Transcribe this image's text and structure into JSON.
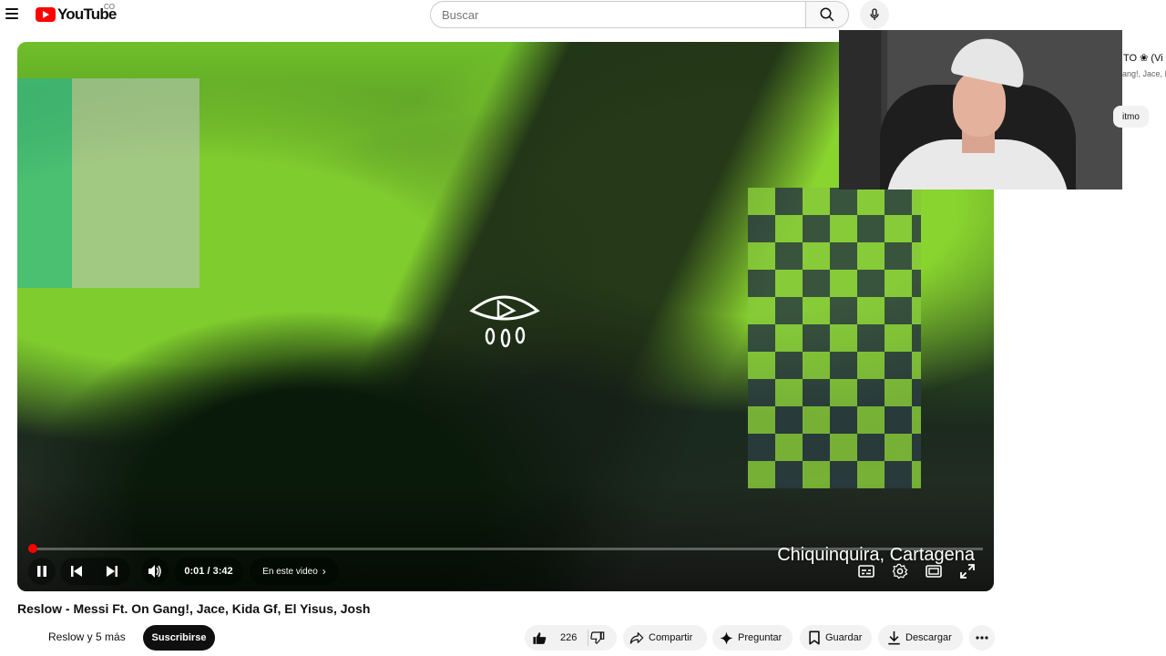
{
  "header": {
    "logo_text": "YouTube",
    "country_code": "CO",
    "search_placeholder": "Buscar"
  },
  "player": {
    "caption": "Chiquinquira, Cartagena",
    "time_display": "0:01 / 3:42",
    "chapter_label": "En este video",
    "progress_fraction": 0.005,
    "accent_color": "#ff0000"
  },
  "sidebar_partial": {
    "line1": "TO ❀ (Vi",
    "line2": "ang!, Jace, I",
    "chip": "itmo"
  },
  "video": {
    "title": "Reslow - Messi Ft. On Gang!, Jace, Kida Gf, El Yisus, Josh",
    "channel": "Reslow y 5 más",
    "subscribe_label": "Suscribirse",
    "like_count": "226",
    "share_label": "Compartir",
    "ask_label": "Preguntar",
    "save_label": "Guardar",
    "download_label": "Descargar"
  }
}
